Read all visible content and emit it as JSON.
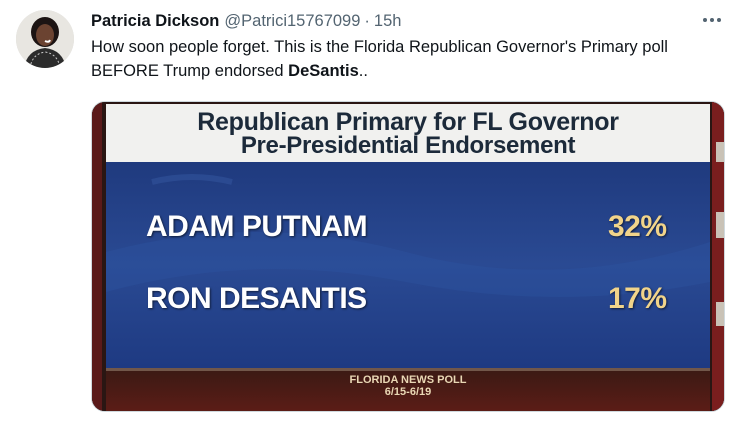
{
  "tweet": {
    "display_name": "Patricia Dickson",
    "handle": "@Patrici15767099",
    "separator": "·",
    "time": "15h",
    "text_part1": "How soon people forget. This is the Florida Republican Governor's Primary poll BEFORE Trump endorsed ",
    "text_bold": "DeSantis",
    "text_end": "..",
    "more_icon": "more-horizontal-icon",
    "avatar": "avatar"
  },
  "poll_image": {
    "title_line1": "Republican Primary for FL Governor",
    "title_line2": "Pre-Presidential Endorsement",
    "rows": [
      {
        "name": "ADAM PUTNAM",
        "value": "32%"
      },
      {
        "name": "RON DESANTIS",
        "value": "17%"
      }
    ],
    "footer_line1": "FLORIDA NEWS POLL",
    "footer_line2": "6/15-6/19",
    "colors": {
      "panel_blue": "#243f86",
      "header_white": "#f1f1ef",
      "value_gold": "#f1d48a",
      "stripe_red": "#8a2020"
    }
  }
}
